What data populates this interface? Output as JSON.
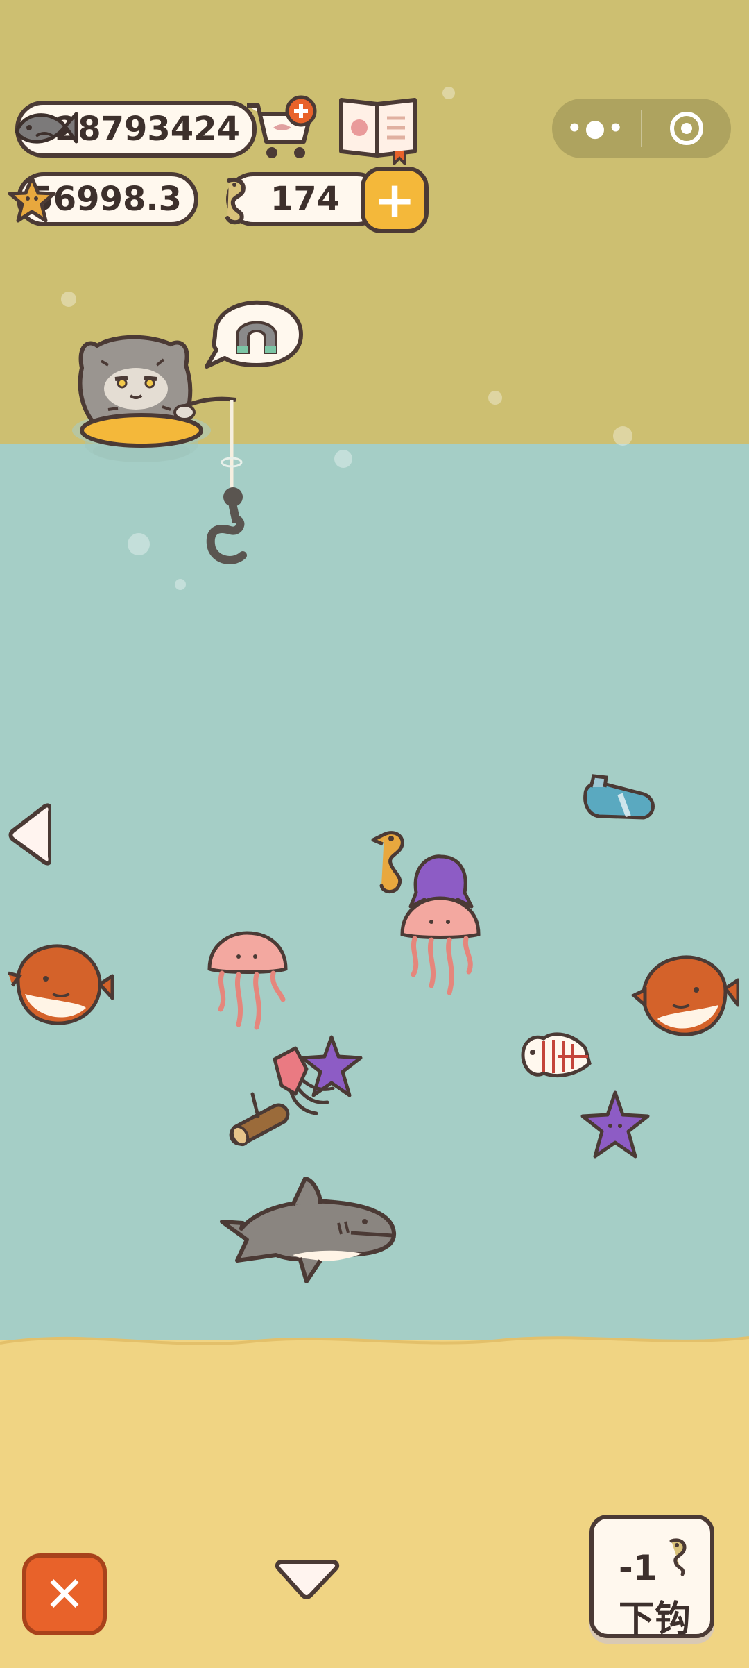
{
  "currencies": {
    "fish_count": "28793424",
    "star_count": "56998.3",
    "bait_count": "174"
  },
  "cast_button": {
    "cost": "-1",
    "label": "下钩"
  },
  "colors": {
    "sky": "#cdbf71",
    "sea": "#a5cec6",
    "sand": "#f0d483",
    "accent_orange": "#e8622a",
    "accent_gold": "#f4b83a",
    "outline": "#4b3a35"
  },
  "icons": [
    "fish-icon",
    "shop-cart-icon",
    "fish-book-icon",
    "starfish-icon",
    "seahorse-bait-icon",
    "add-bait-button",
    "more-menu-icon",
    "target-icon",
    "magnet-thought-bubble",
    "left-arrow-icon",
    "down-arrow-icon",
    "close-icon"
  ]
}
